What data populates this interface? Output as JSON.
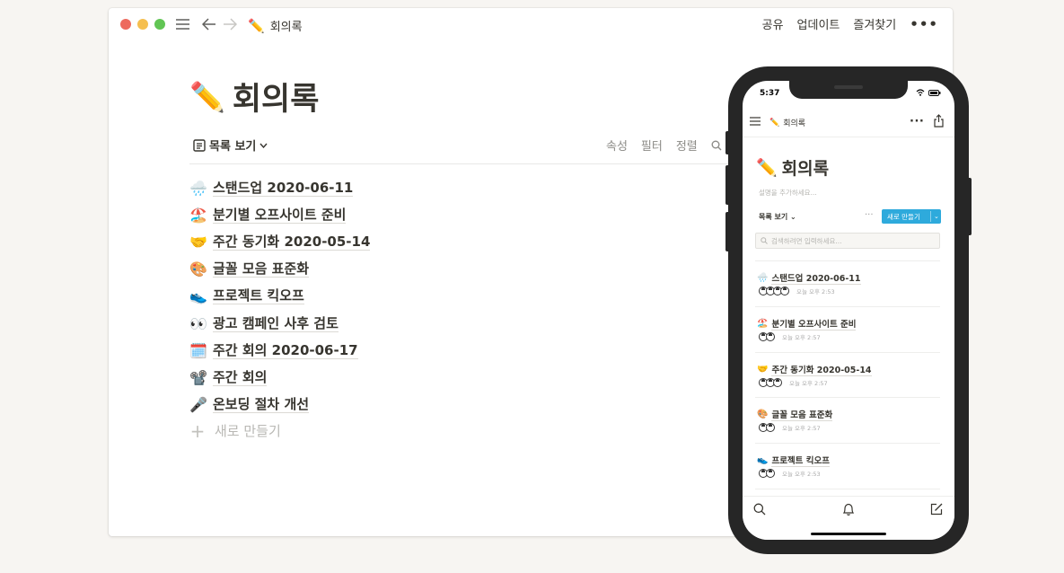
{
  "desktop": {
    "title_emoji": "✏️",
    "breadcrumb": "회의록",
    "header_actions": [
      "공유",
      "업데이트",
      "즐겨찾기"
    ],
    "more": "•••",
    "page_title": "회의록",
    "view_label": "목록 보기",
    "view_tools": [
      "속성",
      "필터",
      "정렬"
    ],
    "items": [
      {
        "emoji": "🌧️",
        "title": "스탠드업 2020-06-11"
      },
      {
        "emoji": "🏖️",
        "title": "분기별 오프사이트 준비"
      },
      {
        "emoji": "🤝",
        "title": "주간 동기화 2020-05-14"
      },
      {
        "emoji": "🎨",
        "title": "글꼴 모음 표준화"
      },
      {
        "emoji": "👟",
        "title": "프로젝트 킥오프"
      },
      {
        "emoji": "👀",
        "title": "광고 캠페인 사후 검토"
      },
      {
        "emoji": "🗓️",
        "title": "주간 회의 2020-06-17"
      },
      {
        "emoji": "📽️",
        "title": "주간 회의"
      },
      {
        "emoji": "🎤",
        "title": "온보딩 절차 개선"
      }
    ],
    "new_label": "새로 만들기"
  },
  "mobile": {
    "time": "5:37",
    "breadcrumb": "회의록",
    "more": "···",
    "page_title": "회의록",
    "description_placeholder": "설명을 추가하세요...",
    "view_label": "목록 보기",
    "view_more": "···",
    "new_button": "새로 만들기",
    "search_placeholder": "검색하려면 입력하세요...",
    "items": [
      {
        "emoji": "🌧️",
        "title": "스탠드업 2020-06-11",
        "time": "오늘 오후 2:53",
        "avatars": 4
      },
      {
        "emoji": "🏖️",
        "title": "분기별 오프사이트 준비",
        "time": "오늘 오후 2:57",
        "avatars": 2
      },
      {
        "emoji": "🤝",
        "title": "주간 동기화 2020-05-14",
        "time": "오늘 오후 2:57",
        "avatars": 3
      },
      {
        "emoji": "🎨",
        "title": "글꼴 모음 표준화",
        "time": "오늘 오후 2:57",
        "avatars": 2
      },
      {
        "emoji": "👟",
        "title": "프로젝트 킥오프",
        "time": "오늘 오후 2:53",
        "avatars": 2
      }
    ]
  }
}
